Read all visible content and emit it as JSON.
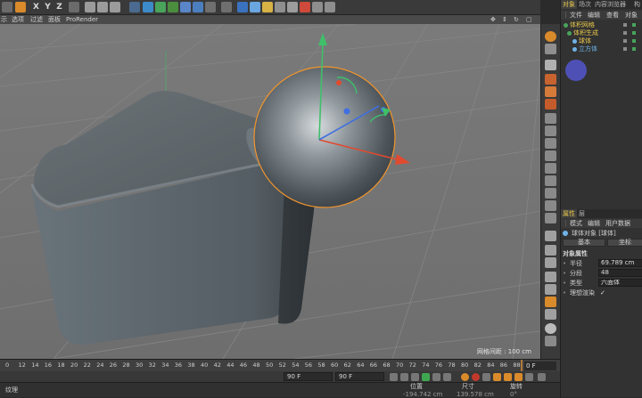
{
  "main_menu": {
    "items": [
      "示",
      "选项",
      "过滤",
      "面板",
      "ProRender"
    ]
  },
  "toolbar": {
    "axis_letters": [
      "X",
      "Y",
      "Z"
    ]
  },
  "viewport": {
    "grid_label": "网格间距 : 100 cm"
  },
  "object_manager": {
    "tabs": [
      "对象",
      "场次",
      "内容浏览器",
      "构"
    ],
    "menu": [
      "文件",
      "编辑",
      "查看",
      "对象"
    ],
    "objects": [
      {
        "name": "体积网格",
        "color": "#e8c84a"
      },
      {
        "name": "体积生成",
        "color": "#e8c84a"
      },
      {
        "name": "球体",
        "color": "#e8c84a"
      },
      {
        "name": "立方体",
        "color": "#6fb3e6"
      }
    ]
  },
  "attributes": {
    "tabs": [
      "属性",
      "层"
    ],
    "menu": [
      "模式",
      "编辑",
      "用户数据"
    ],
    "object_title": "球体对象 [球体]",
    "buttons": [
      "基本",
      "坐标"
    ],
    "section_title": "对象属性",
    "fields": [
      {
        "label": "半径",
        "value": "69.789 cm"
      },
      {
        "label": "分段",
        "value": "48"
      },
      {
        "label": "类型",
        "value": "六面体"
      },
      {
        "label": "理想渲染",
        "value": "✓"
      }
    ]
  },
  "timeline": {
    "ticks": [
      "0",
      "12",
      "14",
      "16",
      "18",
      "20",
      "22",
      "24",
      "26",
      "28",
      "30",
      "32",
      "34",
      "36",
      "38",
      "40",
      "42",
      "44",
      "46",
      "48",
      "50",
      "52",
      "54",
      "56",
      "58",
      "60",
      "62",
      "64",
      "66",
      "68",
      "70",
      "72",
      "74",
      "76",
      "78",
      "80",
      "82",
      "84",
      "86",
      "88",
      "90"
    ],
    "current_frame": "0 F"
  },
  "transport": {
    "field_a": "90 F",
    "field_b": "90 F"
  },
  "bottom_panel": {
    "left_label": "纹理",
    "headers": [
      "位置",
      "尺寸",
      "旋转"
    ],
    "values": [
      "-194.742 cm",
      "139.578 cm",
      "0°"
    ]
  },
  "colors": {
    "accent_orange": "#f2952c",
    "axis_red": "#e04a2f",
    "axis_green": "#3fc06a",
    "axis_blue": "#3f6fe0",
    "selection_yellow": "#e8c84a"
  }
}
